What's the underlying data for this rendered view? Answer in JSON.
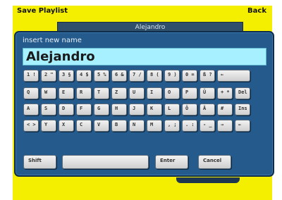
{
  "topbar": {
    "title": "Save Playlist",
    "back": "Back"
  },
  "background_field_text": "Alejandro",
  "dialog": {
    "prompt": "insert new name",
    "name_value": "Alejandro",
    "rows": [
      [
        "1 !",
        "2 \"",
        "3 §",
        "4 $",
        "5 %",
        "6 &",
        "7 /",
        "8 (",
        "9 )",
        "0 =",
        "ß ?",
        "←"
      ],
      [
        "Q",
        "W",
        "E",
        "R",
        "T",
        "Z",
        "U",
        "I",
        "O",
        "P",
        "Ü",
        "+ *",
        "Del"
      ],
      [
        "A",
        "S",
        "D",
        "F",
        "G",
        "H",
        "J",
        "K",
        "L",
        "Ö",
        "Ä",
        "#",
        "Ins"
      ],
      [
        "< >",
        "Y",
        "X",
        "C",
        "V",
        "B",
        "N",
        "M",
        ", ;",
        ". :",
        "- _",
        "→",
        "←"
      ]
    ],
    "bottom": {
      "shift": "Shift",
      "space": "",
      "enter": "Enter",
      "cancel": "Cancel"
    }
  }
}
